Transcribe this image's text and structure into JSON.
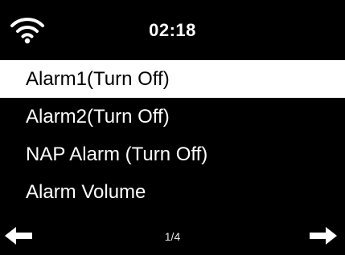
{
  "status_bar": {
    "wifi_icon": "wifi-icon",
    "time": "02:18"
  },
  "menu": {
    "items": [
      {
        "label": "Alarm1(Turn Off)",
        "selected": true
      },
      {
        "label": "Alarm2(Turn Off)",
        "selected": false
      },
      {
        "label": "NAP Alarm (Turn Off)",
        "selected": false
      },
      {
        "label": "Alarm Volume",
        "selected": false
      }
    ]
  },
  "footer": {
    "left_icon": "arrow-left-icon",
    "page": "1/4",
    "right_icon": "arrow-right-icon"
  },
  "colors": {
    "background": "#000000",
    "foreground": "#ffffff",
    "highlight_bg": "#ffffff",
    "highlight_text": "#000000"
  }
}
